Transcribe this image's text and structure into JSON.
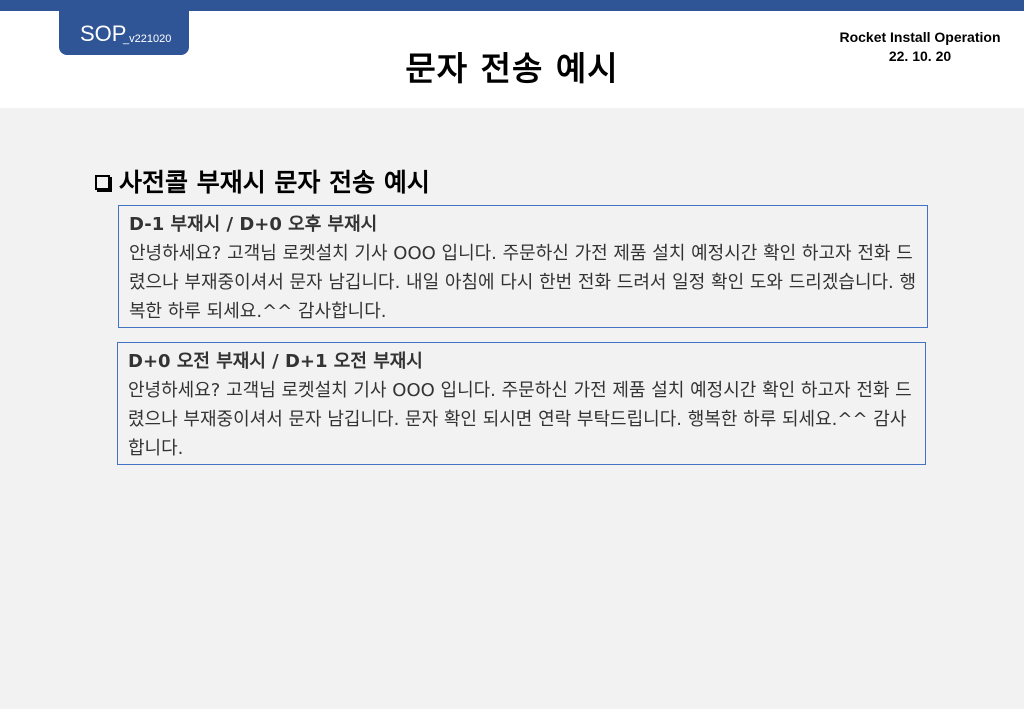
{
  "header": {
    "sop_label": "SOP",
    "sop_version": "_v221020",
    "title": "문자 전송 예시",
    "company": "Rocket Install Operation",
    "date": "22. 10. 20"
  },
  "section": {
    "heading": "사전콜 부재시 문자 전송 예시"
  },
  "messages": [
    {
      "label": "D-1 부재시 / D+0 오후 부재시",
      "body": "안녕하세요? 고객님 로켓설치 기사 OOO 입니다. 주문하신 가전 제품 설치 예정시간 확인 하고자 전화 드렸으나 부재중이셔서 문자 남깁니다. 내일 아침에 다시 한번 전화 드려서 일정 확인 도와 드리겠습니다. 행복한 하루 되세요.^^ 감사합니다."
    },
    {
      "label": "D+0 오전 부재시 / D+1 오전 부재시",
      "body": "안녕하세요? 고객님 로켓설치 기사 OOO 입니다. 주문하신 가전 제품 설치 예정시간 확인 하고자 전화 드렸으나 부재중이셔서 문자 남깁니다. 문자 확인 되시면 연락 부탁드립니다. 행복한 하루 되세요.^^ 감사합니다."
    }
  ]
}
